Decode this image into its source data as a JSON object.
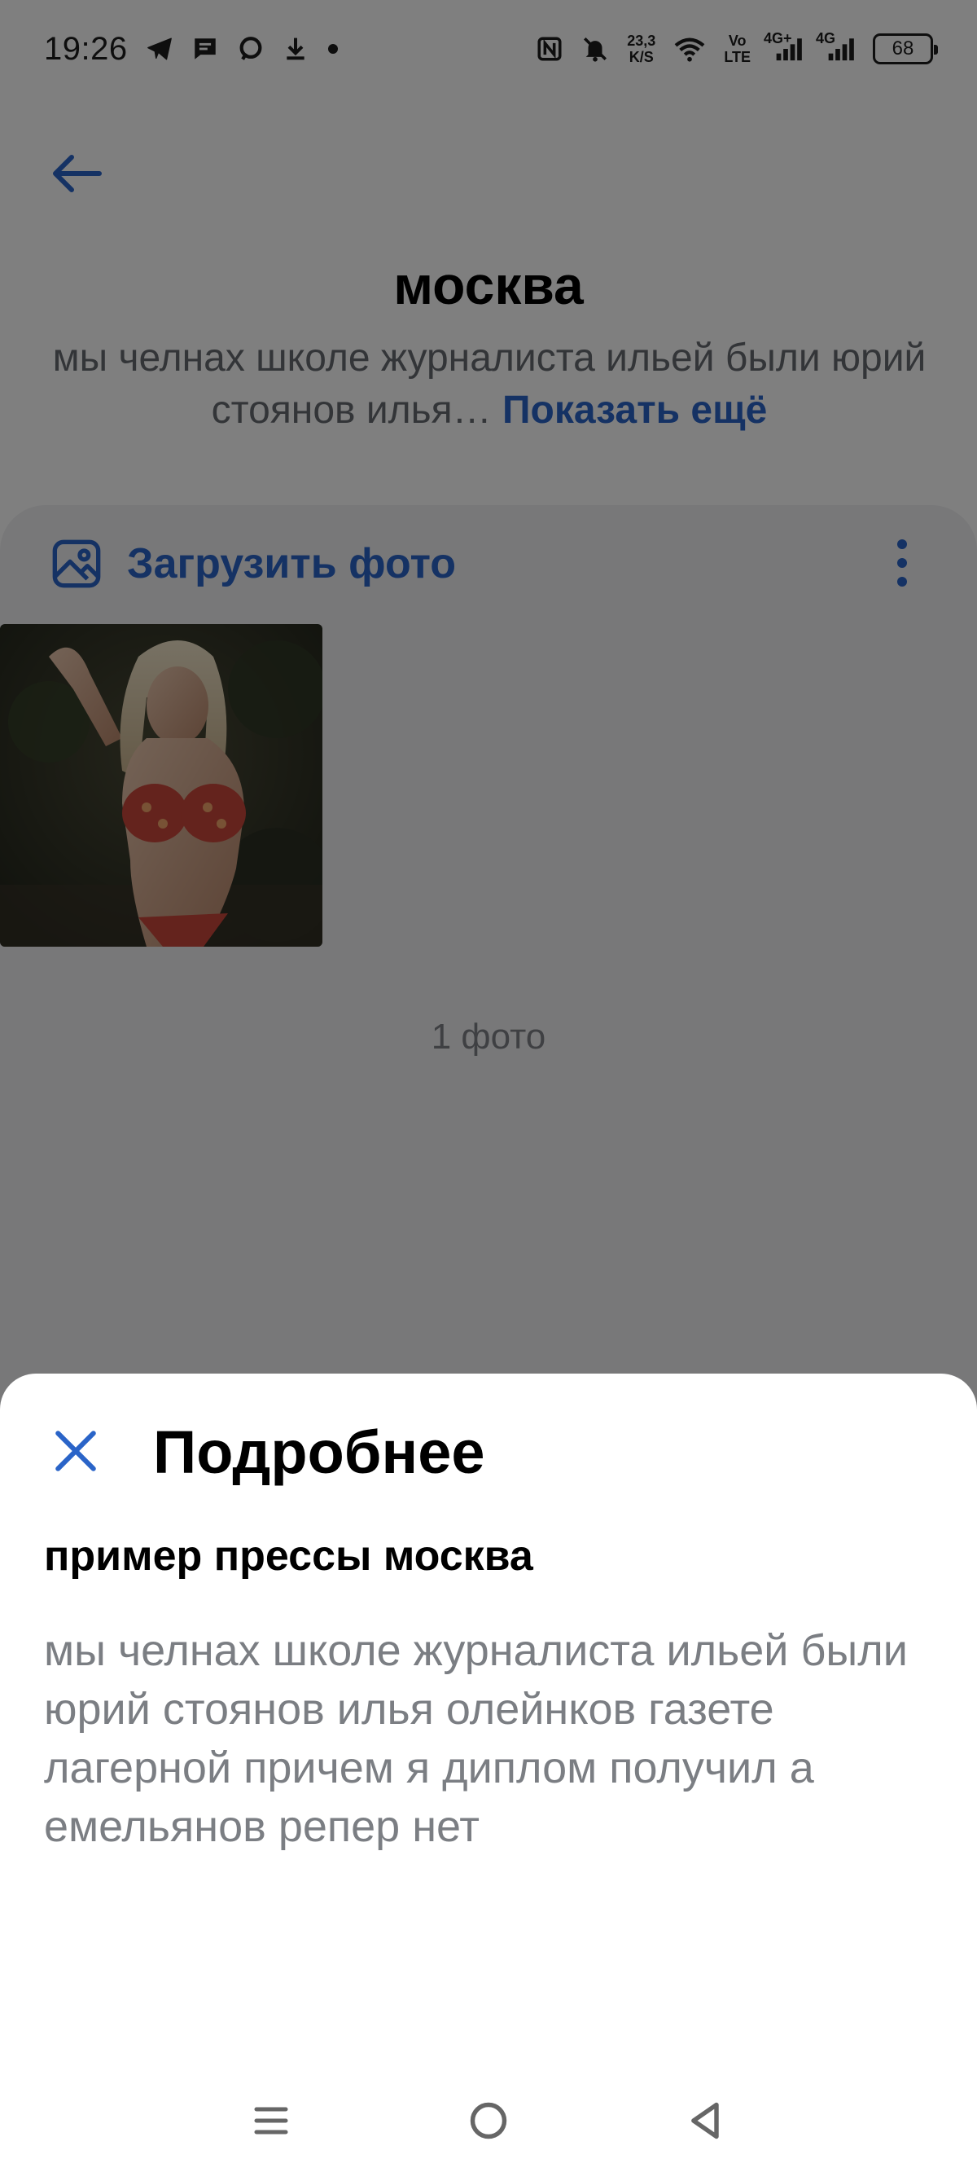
{
  "status_bar": {
    "time": "19:26",
    "net_speed_value": "23,3",
    "net_speed_unit": "K/S",
    "volte_top": "Vo",
    "volte_bottom": "LTE",
    "net1": "4G+",
    "net2": "4G",
    "battery": "68"
  },
  "header": {
    "title": "москва",
    "description": "мы челнах школе журналиста ильей были юрий стоянов илья…",
    "show_more": "Показать ещё"
  },
  "album": {
    "upload_label": "Загрузить фото",
    "photo_count": "1 фото"
  },
  "sheet": {
    "title": "Подробнее",
    "subtitle": "пример прессы москва",
    "body": "мы челнах школе журналиста ильей были юрий стоянов илья олейнков газете лагерной причем я диплом получил а емельянов репер нет"
  },
  "colors": {
    "accent": "#2a64c8",
    "secondary_text": "#7b7e83",
    "card_background": "#f0f1f3",
    "overlay": "rgba(0,0,0,0.5)"
  }
}
